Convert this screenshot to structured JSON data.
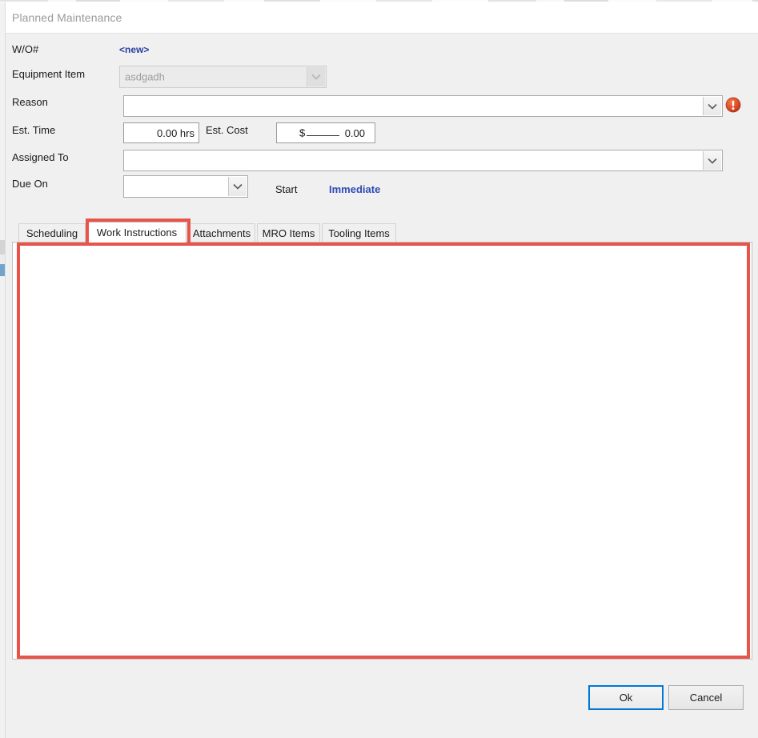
{
  "window": {
    "title": "Planned Maintenance"
  },
  "form": {
    "wo_label": "W/O#",
    "wo_value": "<new>",
    "equipment_label": "Equipment Item",
    "equipment_value": "asdgadh",
    "reason_label": "Reason",
    "reason_value": "",
    "est_time_label": "Est. Time",
    "est_time_value": "0.00 hrs",
    "est_cost_label": "Est. Cost",
    "est_cost_currency": "$",
    "est_cost_value": "0.00",
    "assigned_to_label": "Assigned To",
    "assigned_to_value": "",
    "due_on_label": "Due On",
    "due_on_value": "",
    "start_label": "Start",
    "immediate_link": "Immediate"
  },
  "icons": {
    "error": "error-exclamation-icon",
    "dropdown": "chevron-down-icon"
  },
  "tabs": [
    {
      "label": "Scheduling",
      "active": false
    },
    {
      "label": "Work Instructions",
      "active": true
    },
    {
      "label": "Attachments",
      "active": false
    },
    {
      "label": "MRO Items",
      "active": false
    },
    {
      "label": "Tooling Items",
      "active": false
    }
  ],
  "content": {
    "work_instructions_text": ""
  },
  "footer": {
    "ok_label": "Ok",
    "cancel_label": "Cancel"
  },
  "colors": {
    "link": "#2f4bb5",
    "error": "#e0512c",
    "highlight": "#e8544a",
    "focus": "#0078d7"
  }
}
